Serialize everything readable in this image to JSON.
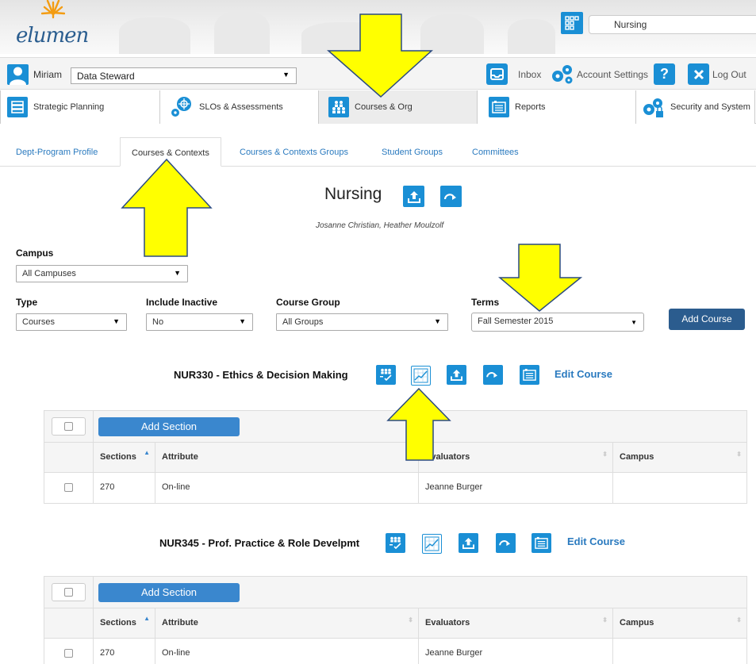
{
  "header": {
    "logo_text": "elumen",
    "department_value": "Nursing"
  },
  "userbar": {
    "user_name": "Miriam",
    "role_value": "Data Steward",
    "inbox_label": "Inbox",
    "account_settings_label": "Account Settings",
    "help_label": "?",
    "logout_label": "Log Out"
  },
  "main_tabs": [
    {
      "label": "Strategic Planning",
      "icon": "strategic-planning-icon"
    },
    {
      "label": "SLOs & Assessments",
      "icon": "slos-icon"
    },
    {
      "label": "Courses & Org",
      "icon": "courses-org-icon"
    },
    {
      "label": "Reports",
      "icon": "reports-icon"
    },
    {
      "label": "Security and System",
      "icon": "security-icon"
    }
  ],
  "sub_tabs": [
    {
      "label": "Dept-Program Profile"
    },
    {
      "label": "Courses & Contexts"
    },
    {
      "label": "Courses & Contexts Groups"
    },
    {
      "label": "Student Groups"
    },
    {
      "label": "Committees"
    }
  ],
  "page": {
    "title": "Nursing",
    "subtitle": "Josanne Christian, Heather Moulzolf"
  },
  "filters": {
    "campus_label": "Campus",
    "campus_value": "All Campuses",
    "type_label": "Type",
    "type_value": "Courses",
    "inactive_label": "Include Inactive",
    "inactive_value": "No",
    "group_label": "Course Group",
    "group_value": "All Groups",
    "terms_label": "Terms",
    "terms_value": "Fall Semester 2015",
    "add_course_label": "Add Course"
  },
  "courses": [
    {
      "title": "NUR330 - Ethics & Decision Making",
      "edit_label": "Edit Course",
      "add_section_label": "Add Section",
      "columns": [
        "Sections",
        "Attribute",
        "Evaluators",
        "Campus"
      ],
      "rows": [
        {
          "section": "270",
          "attribute": "On-line",
          "evaluators": "Jeanne Burger",
          "campus": ""
        }
      ]
    },
    {
      "title": "NUR345 - Prof. Practice & Role Develpmt",
      "edit_label": "Edit Course",
      "add_section_label": "Add Section",
      "columns": [
        "Sections",
        "Attribute",
        "Evaluators",
        "Campus"
      ],
      "rows": [
        {
          "section": "270",
          "attribute": "On-line",
          "evaluators": "Jeanne Burger",
          "campus": ""
        }
      ]
    }
  ],
  "colors": {
    "accent": "#1a8fd5",
    "button_dark": "#2b5c8e",
    "button": "#3a87ce",
    "highlight_arrow": "#ffff00",
    "link": "#2a7abf"
  }
}
